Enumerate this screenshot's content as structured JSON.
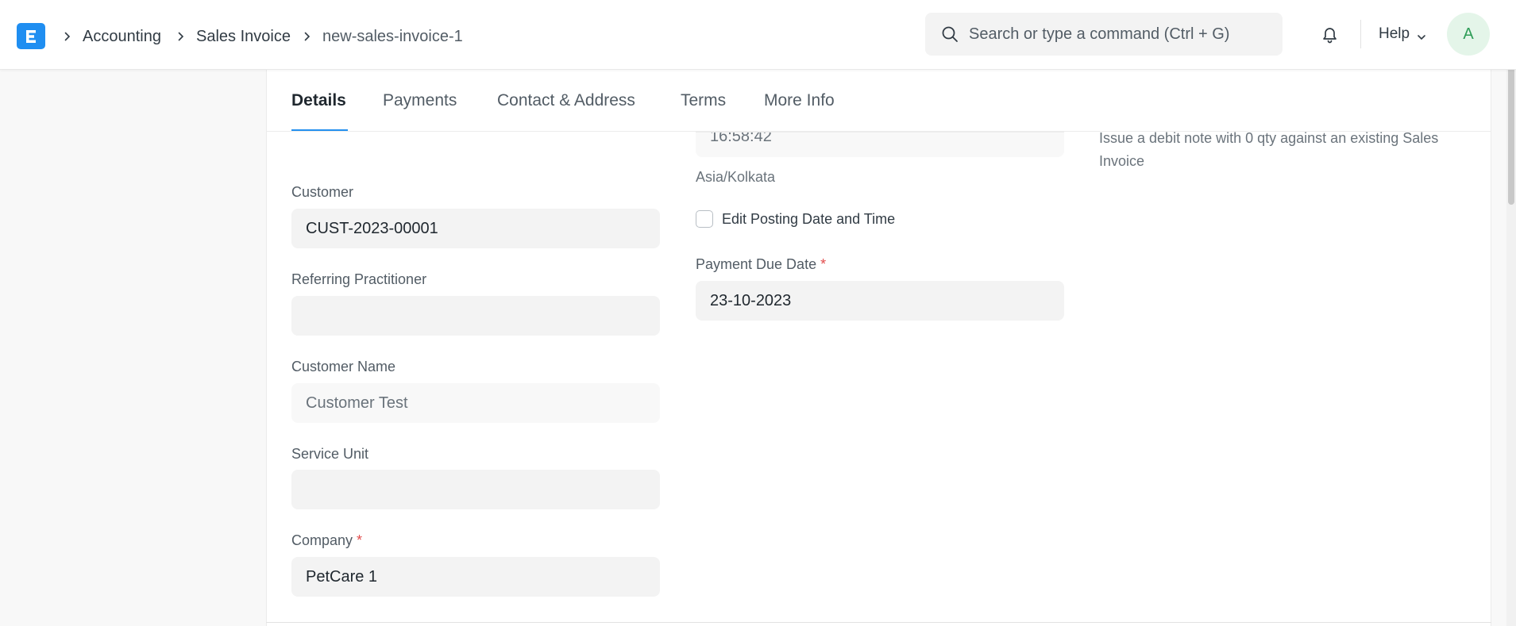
{
  "navbar": {
    "logo_letter": "E",
    "breadcrumbs": [
      "Accounting",
      "Sales Invoice",
      "new-sales-invoice-1"
    ],
    "search_placeholder": "Search or type a command (Ctrl + G)",
    "help_label": "Help",
    "avatar_initial": "A"
  },
  "tabs": [
    "Details",
    "Payments",
    "Contact & Address",
    "Terms",
    "More Info"
  ],
  "form": {
    "customer_label": "Customer",
    "customer_value": "CUST-2023-00001",
    "referring_label": "Referring Practitioner",
    "referring_value": "",
    "customer_name_label": "Customer Name",
    "customer_name_value": "Customer Test",
    "service_unit_label": "Service Unit",
    "service_unit_value": "",
    "company_label": "Company",
    "company_value": "PetCare 1",
    "posting_time_value": "16:58:42",
    "timezone_text": "Asia/Kolkata",
    "edit_posting_label": "Edit Posting Date and Time",
    "payment_due_label": "Payment Due Date",
    "payment_due_value": "23-10-2023",
    "required_marker": "*",
    "debit_note_help": "Issue a debit note with 0 qty against an existing Sales Invoice"
  },
  "colors": {
    "accent": "#2490ef",
    "logo_bg": "#1f8ef1",
    "required": "#e24c4c",
    "avatar_bg": "#e4f5e9",
    "avatar_fg": "#2f9d58"
  },
  "icons": [
    "app-logo-icon",
    "chevron-right-icon",
    "search-icon",
    "bell-icon",
    "chevron-down-icon"
  ]
}
